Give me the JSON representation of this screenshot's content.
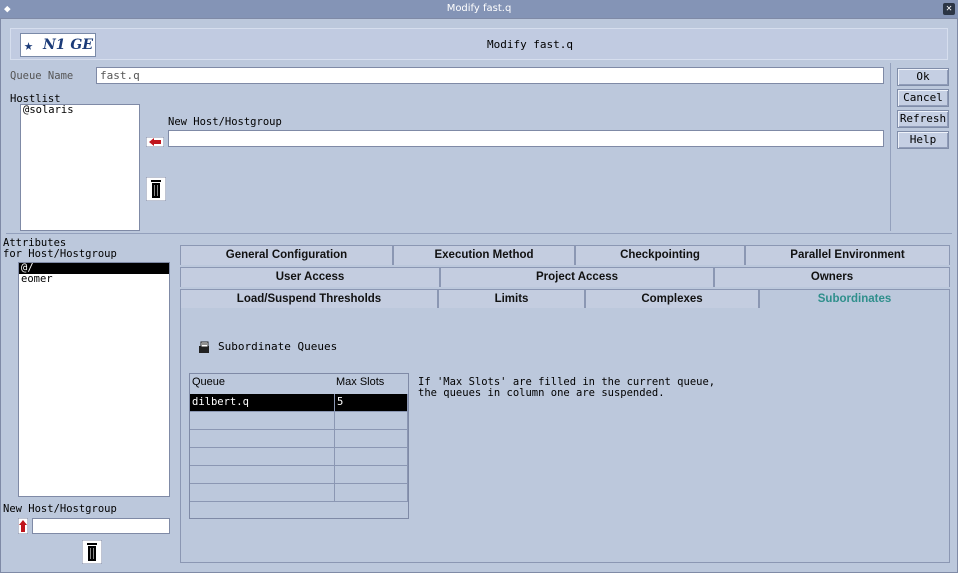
{
  "window": {
    "title": "Modify fast.q"
  },
  "header": {
    "logo_text": "N1 GE",
    "title": "Modify fast.q"
  },
  "queue": {
    "name_label": "Queue Name",
    "name_value": "fast.q"
  },
  "hostlist": {
    "label": "Hostlist",
    "items": [
      "@solaris"
    ],
    "new_label": "New Host/Hostgroup",
    "new_value": ""
  },
  "side_buttons": {
    "ok": "Ok",
    "cancel": "Cancel",
    "refresh": "Refresh",
    "help": "Help"
  },
  "attributes": {
    "label_line1": "Attributes",
    "label_line2": "for Host/Hostgroup",
    "items": [
      "@/",
      "eomer"
    ],
    "new_label": "New Host/Hostgroup",
    "new_value": ""
  },
  "tabs": {
    "row1": [
      "General Configuration",
      "Execution Method",
      "Checkpointing",
      "Parallel Environment"
    ],
    "row2": [
      "User Access",
      "Project Access",
      "Owners"
    ],
    "row3": [
      "Load/Suspend Thresholds",
      "Limits",
      "Complexes",
      "Subordinates"
    ],
    "active": "Subordinates"
  },
  "subordinates": {
    "section_title": "Subordinate Queues",
    "columns": [
      "Queue",
      "Max Slots"
    ],
    "rows": [
      [
        "dilbert.q",
        "5"
      ],
      [
        "",
        ""
      ],
      [
        "",
        ""
      ],
      [
        "",
        ""
      ],
      [
        "",
        ""
      ],
      [
        "",
        ""
      ]
    ],
    "note_line1": "If 'Max Slots' are filled in the current queue,",
    "note_line2": "the queues in column one are suspended."
  },
  "colors": {
    "accent_tab": "#2f8f8c",
    "titlebar": "#8494b6",
    "background": "#bcc8dc"
  }
}
